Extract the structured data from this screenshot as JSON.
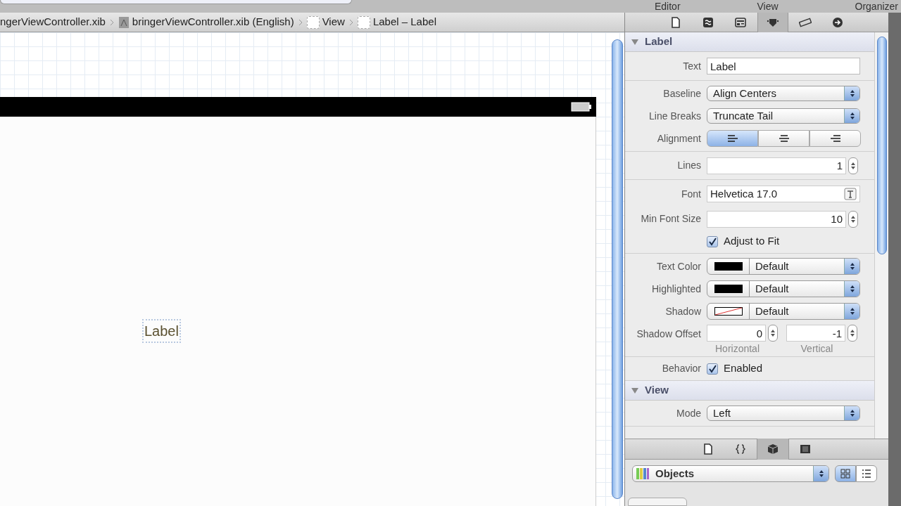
{
  "toolbar": {
    "labels": [
      "Editor",
      "View",
      "Organizer"
    ]
  },
  "breadcrumb": [
    {
      "label": "ngerViewController.xib",
      "kind": "file"
    },
    {
      "label": "bringerViewController.xib (English)",
      "kind": "xib"
    },
    {
      "label": "View",
      "kind": "view"
    },
    {
      "label": "Label – Label",
      "kind": "view"
    }
  ],
  "canvas": {
    "label": {
      "text": "Label",
      "selected": true
    }
  },
  "inspector": {
    "tabs": [
      {
        "kind": "file",
        "selected": false
      },
      {
        "kind": "help",
        "selected": false
      },
      {
        "kind": "identity",
        "selected": false
      },
      {
        "kind": "attributes",
        "selected": true
      },
      {
        "kind": "size",
        "selected": false
      },
      {
        "kind": "connections",
        "selected": false
      }
    ],
    "sections": [
      {
        "title": "Label",
        "expanded": true,
        "groups": [
          [
            {
              "kind": "text",
              "label": "Text",
              "value": "Label"
            }
          ],
          [
            {
              "kind": "popup",
              "label": "Baseline",
              "value": "Align Centers"
            },
            {
              "kind": "popup",
              "label": "Line Breaks",
              "value": "Truncate Tail"
            },
            {
              "kind": "segmented",
              "label": "Alignment",
              "segments": [
                {
                  "kind": "left",
                  "selected": true
                },
                {
                  "kind": "center",
                  "selected": false
                },
                {
                  "kind": "right",
                  "selected": false
                }
              ]
            }
          ],
          [
            {
              "kind": "stepper",
              "label": "Lines",
              "value": "1"
            }
          ],
          [
            {
              "kind": "font",
              "label": "Font",
              "value": "Helvetica 17.0"
            },
            {
              "kind": "stepper",
              "label": "Min Font Size",
              "value": "10"
            },
            {
              "kind": "checkbox",
              "text": "Adjust to Fit",
              "checked": true
            }
          ],
          [
            {
              "kind": "color",
              "label": "Text Color",
              "swatch": {
                "kind": "solid"
              },
              "value": "Default"
            },
            {
              "kind": "color",
              "label": "Highlighted",
              "swatch": {
                "kind": "solid"
              },
              "value": "Default"
            },
            {
              "kind": "color",
              "label": "Shadow",
              "swatch": {
                "kind": "none"
              },
              "value": "Default"
            },
            {
              "kind": "offset",
              "label": "Shadow Offset",
              "fields": [
                {
                  "value": "0",
                  "caption": "Horizontal"
                },
                {
                  "value": "-1",
                  "caption": "Vertical"
                }
              ]
            }
          ],
          [
            {
              "kind": "checkbox",
              "label": "Behavior",
              "text": "Enabled",
              "checked": true
            }
          ]
        ]
      },
      {
        "title": "View",
        "expanded": true,
        "groups": [
          [
            {
              "kind": "popup",
              "label": "Mode",
              "value": "Left"
            }
          ]
        ]
      }
    ]
  },
  "library": {
    "tabs": [
      {
        "kind": "file",
        "selected": false
      },
      {
        "kind": "code",
        "selected": false
      },
      {
        "kind": "object",
        "selected": true
      },
      {
        "kind": "media",
        "selected": false
      }
    ],
    "popup": "Objects",
    "views": [
      {
        "kind": "grid",
        "selected": true
      },
      {
        "kind": "list",
        "selected": false
      }
    ]
  }
}
